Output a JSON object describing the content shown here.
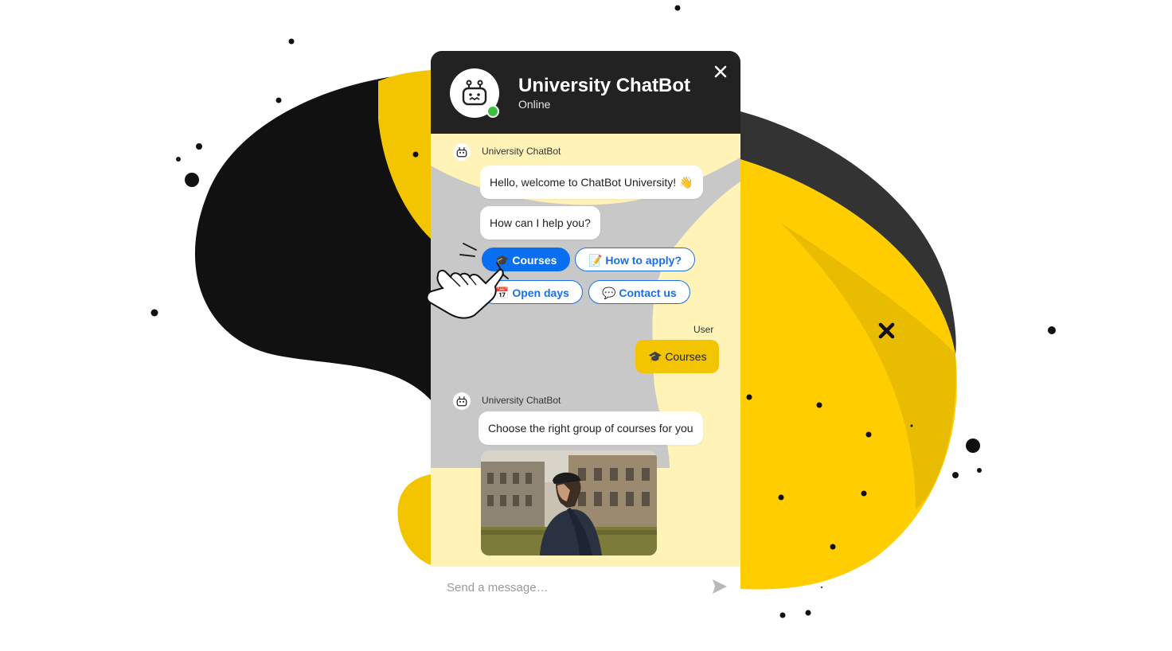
{
  "theme": {
    "accent_blue": "#0a6ef0",
    "yellow": "#f2c500",
    "dark": "#222222",
    "online_green": "#3ec23e"
  },
  "header": {
    "title": "University ChatBot",
    "status": "Online",
    "avatar_icon": "robot-icon",
    "close_icon": "close-icon"
  },
  "messages": {
    "bot_name_1": "University ChatBot",
    "greeting": "Hello, welcome to ChatBot University! 👋",
    "help_prompt": "How can I help you?",
    "quick_replies": [
      {
        "label": "Courses",
        "emoji": "🎓",
        "active": true
      },
      {
        "label": "How to apply?",
        "emoji": "📝",
        "active": false
      },
      {
        "label": "Open days",
        "emoji": "📅",
        "active": false
      },
      {
        "label": "Contact us",
        "emoji": "💬",
        "active": false
      }
    ],
    "user_name": "User",
    "user_reply": "🎓 Courses",
    "bot_name_2": "University ChatBot",
    "courses_prompt": "Choose the right group of courses for you"
  },
  "composer": {
    "placeholder": "Send a message…",
    "send_icon": "send-icon"
  }
}
